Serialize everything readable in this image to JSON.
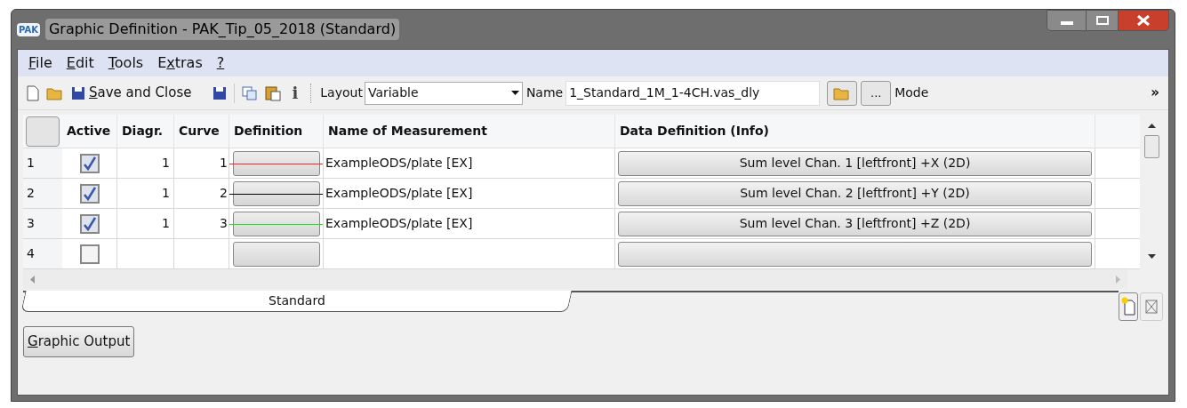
{
  "window": {
    "app_badge": "PAK",
    "title": "Graphic Definition - PAK_Tip_05_2018 (Standard)"
  },
  "menu": [
    {
      "accel": "F",
      "after": "ile"
    },
    {
      "accel": "E",
      "after": "dit"
    },
    {
      "accel": "T",
      "after": "ools"
    },
    {
      "before": "E",
      "accel": "x",
      "after": "tras"
    },
    {
      "accel": "?"
    }
  ],
  "toolbar": {
    "save_close": {
      "accel": "S",
      "after": "ave and Close"
    },
    "info_glyph": "i",
    "layout_label": "Layout",
    "layout_value": "Variable",
    "name_label": "Name",
    "name_value": "1_Standard_1M_1-4CH.vas_dly",
    "browse_label": "...",
    "mode_label": "Mode",
    "overflow": "»"
  },
  "table": {
    "columns": [
      "Active",
      "Diagr.",
      "Curve",
      "Definition",
      "Name of Measurement",
      "Data Definition (Info)"
    ],
    "rows": [
      {
        "index": "1",
        "active": true,
        "diagram": "1",
        "curve": "1",
        "color": "#ff2020",
        "measurement": "ExampleODS/plate [EX]",
        "data_definition": "Sum level Chan. 1 [leftfront] +X (2D)"
      },
      {
        "index": "2",
        "active": true,
        "diagram": "1",
        "curve": "2",
        "color": "#000000",
        "measurement": "ExampleODS/plate [EX]",
        "data_definition": "Sum level Chan. 2 [leftfront] +Y (2D)"
      },
      {
        "index": "3",
        "active": true,
        "diagram": "1",
        "curve": "3",
        "color": "#20e020",
        "measurement": "ExampleODS/plate [EX]",
        "data_definition": "Sum level Chan. 3 [leftfront] +Z (2D)"
      },
      {
        "index": "4",
        "active": false,
        "diagram": "",
        "curve": "",
        "color": null,
        "measurement": "",
        "data_definition": ""
      }
    ]
  },
  "tabs": [
    {
      "label": "Standard",
      "selected": true
    }
  ],
  "graphic_output": {
    "accel": "G",
    "after": "raphic Output"
  }
}
